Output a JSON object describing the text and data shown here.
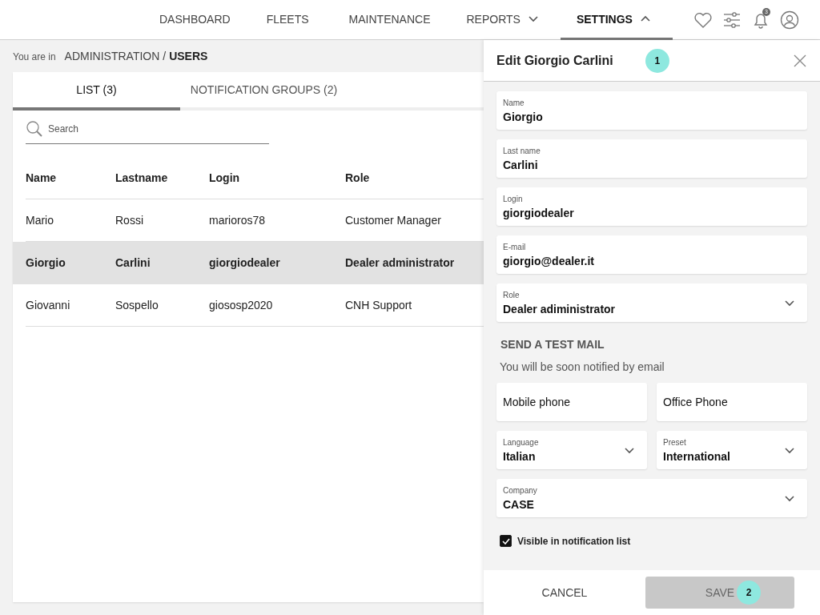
{
  "nav": {
    "items": [
      {
        "label": "DASHBOARD",
        "selected": false
      },
      {
        "label": "FLEETS",
        "selected": false
      },
      {
        "label": "MAINTENANCE",
        "selected": false
      },
      {
        "label": "REPORTS",
        "selected": false,
        "expanded": false
      },
      {
        "label": "SETTINGS",
        "selected": true,
        "expanded": true
      }
    ],
    "notification_count": "3"
  },
  "breadcrumb": {
    "prefix": "You are in",
    "path": "ADMINISTRATION /",
    "current": "USERS"
  },
  "tabs": [
    {
      "label": "LIST (3)",
      "selected": true
    },
    {
      "label": "NOTIFICATION GROUPS (2)",
      "selected": false
    }
  ],
  "search": {
    "placeholder": "Search"
  },
  "table": {
    "columns": [
      "Name",
      "Lastname",
      "Login",
      "Role"
    ],
    "rows": [
      {
        "cells": [
          "Mario",
          "Rossi",
          "marioros78",
          "Customer Manager"
        ],
        "selected": false
      },
      {
        "cells": [
          "Giorgio",
          "Carlini",
          "giorgiodealer",
          "Dealer administrator"
        ],
        "selected": true
      },
      {
        "cells": [
          "Giovanni",
          "Sospello",
          "giososp2020",
          "CNH Support"
        ],
        "selected": false
      }
    ]
  },
  "panel": {
    "title": "Edit Giorgio Carlini",
    "title_marker": "1",
    "fields": [
      {
        "kind": "text",
        "label": "Name",
        "value": "Giorgio"
      },
      {
        "kind": "text",
        "label": "Last name",
        "value": "Carlini"
      },
      {
        "kind": "text",
        "label": "Login",
        "value": "giorgiodealer"
      },
      {
        "kind": "text",
        "label": "E-mail",
        "value": "giorgio@dealer.it"
      },
      {
        "kind": "select",
        "label": "Role",
        "value": "Dealer adiministrator"
      }
    ],
    "section_title": "SEND A TEST MAIL",
    "section_note": "You will be soon notified by email",
    "phones": [
      {
        "placeholder": "Mobile phone"
      },
      {
        "placeholder": "Office Phone"
      }
    ],
    "selects": [
      {
        "label": "Language",
        "value": "Italian"
      },
      {
        "label": "Preset",
        "value": "International"
      }
    ],
    "company": {
      "label": "Company",
      "value": "CASE"
    },
    "visible_in_list": {
      "label": "Visible in notification list",
      "checked": true
    },
    "cancel": "CANCEL",
    "save": "SAVE",
    "save_marker": "2"
  }
}
